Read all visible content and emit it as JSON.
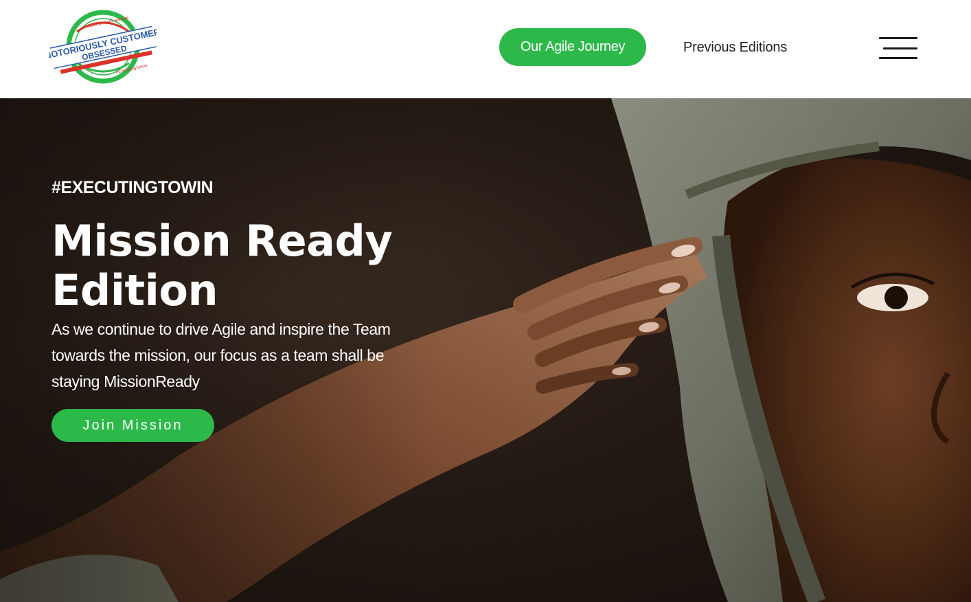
{
  "header": {
    "logo": {
      "top_arc": "MISSION READY EDITION",
      "line1": "NOTORIOUSLY CUSTOMER",
      "line2": "OBSESSED",
      "bottom_arc": "#ExecutingToWin"
    },
    "cta_label": "Our Agile Journey",
    "link_label": "Previous Editions",
    "menu_icon": "hamburger-menu-icon"
  },
  "hero": {
    "eyebrow": "#EXECUTINGTOWIN",
    "title": "Mission Ready Edition",
    "description": "As we continue to drive Agile and inspire the Team towards the mission, our focus as a team shall be staying MissionReady",
    "button_label": "Join Mission",
    "image_alt": "soldier-salute-photo"
  },
  "colors": {
    "accent_green": "#2db84a",
    "logo_blue": "#2a5aa8",
    "logo_red": "#d9342b",
    "hero_dark": "#1a120d"
  }
}
